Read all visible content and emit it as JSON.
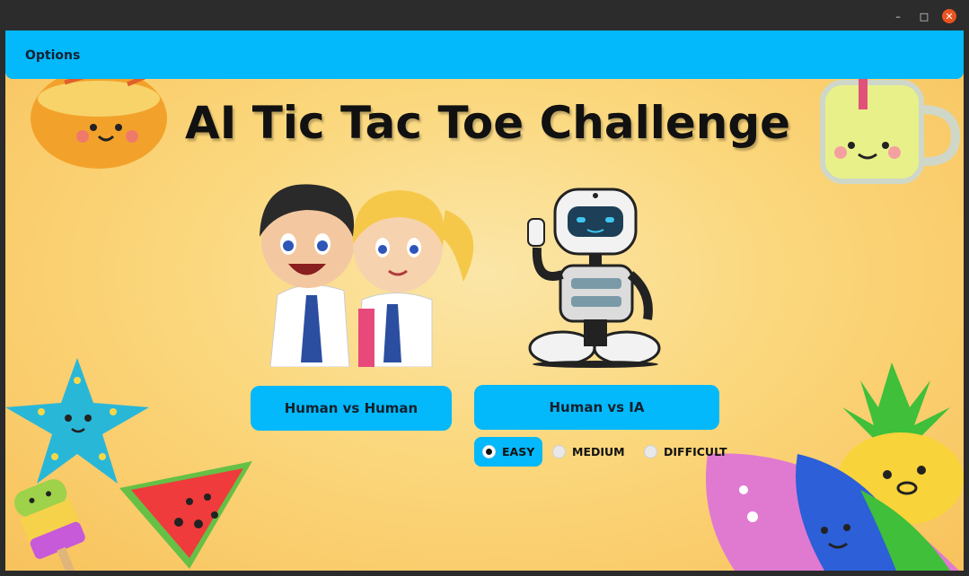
{
  "window": {
    "controls": {
      "minimize": "–",
      "maximize": "□",
      "close": "✕"
    }
  },
  "menu": {
    "options_label": "Options"
  },
  "header": {
    "title": "AI Tic Tac Toe Challenge"
  },
  "modes": {
    "human_vs_human": "Human vs Human",
    "human_vs_ai": "Human vs IA"
  },
  "difficulty": {
    "options": [
      "EASY",
      "MEDIUM",
      "DIFFICULT"
    ],
    "selected": "EASY"
  },
  "colors": {
    "accent": "#03b8fb",
    "titlebar": "#2c2c2c",
    "close": "#e95420"
  },
  "illustrations": [
    "kids-illustration",
    "robot-illustration",
    "ramen-bowl-character",
    "lemonade-jar-character",
    "starfish-character",
    "popsicle-character",
    "watermelon-character",
    "pineapple-character",
    "surfboard-character"
  ]
}
